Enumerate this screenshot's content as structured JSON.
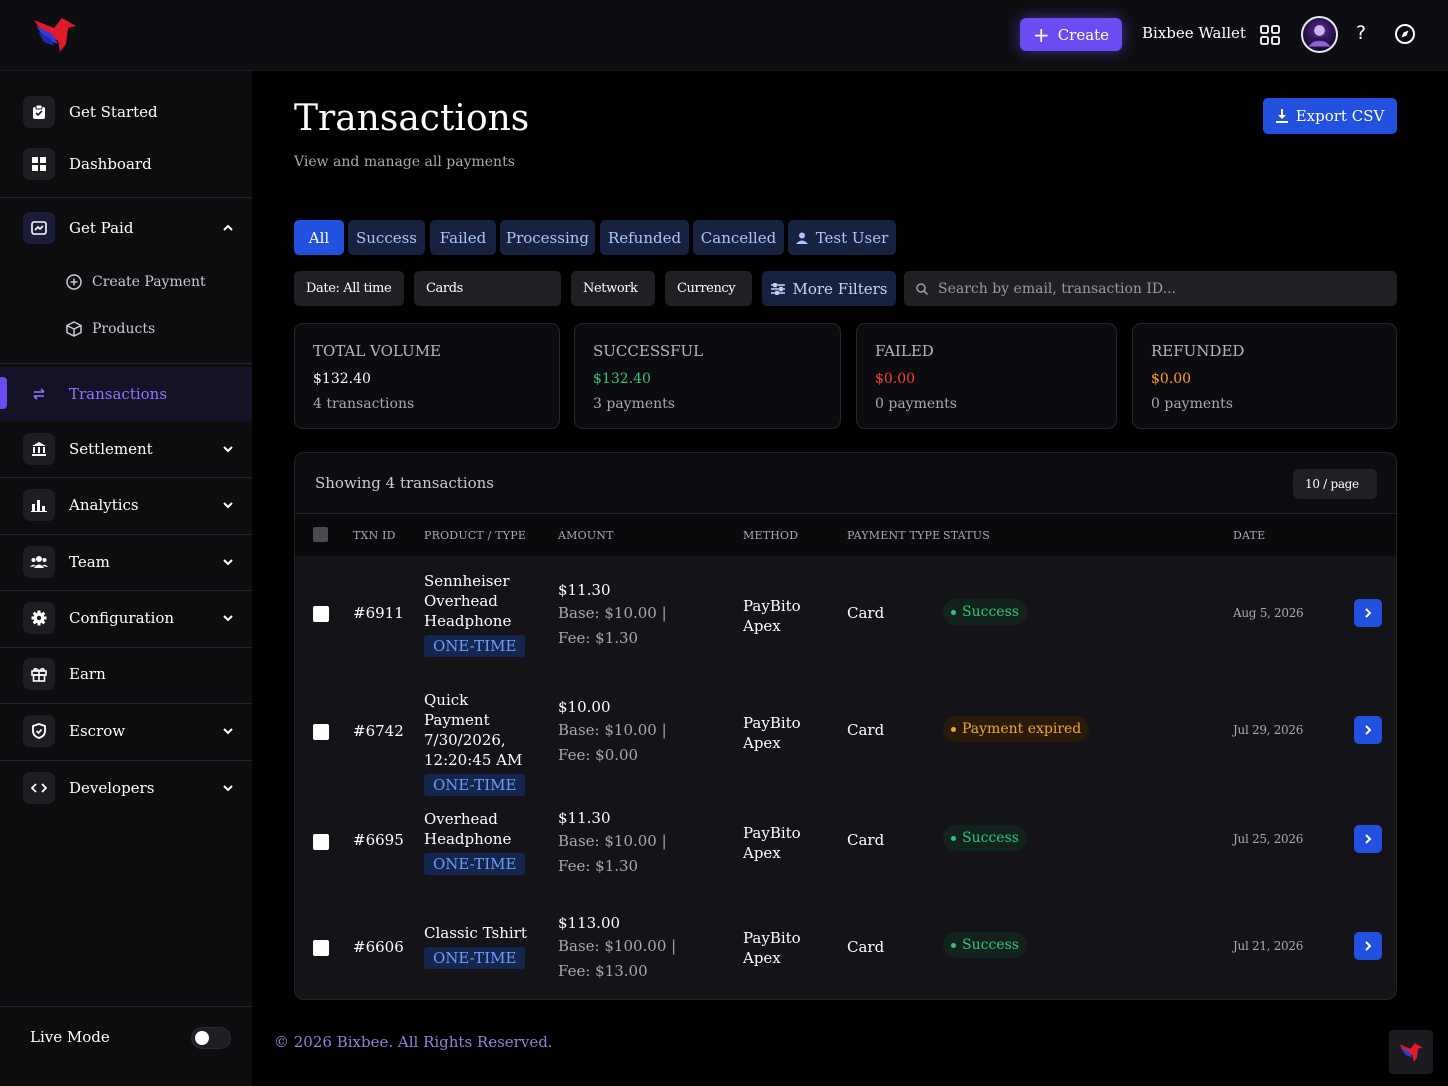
{
  "topbar": {
    "create_label": "Create",
    "wallet_label": "Bixbee Wallet",
    "help_label": "?"
  },
  "sidebar": {
    "items": [
      {
        "label": "Get Started",
        "icon": "clipboard-icon"
      },
      {
        "label": "Dashboard",
        "icon": "grid-icon"
      },
      {
        "label": "Get Paid",
        "icon": "payments-icon",
        "expanded": true
      },
      {
        "label": "Transactions",
        "icon": "transfer-icon",
        "active": true
      },
      {
        "label": "Settlement",
        "icon": "bank-icon"
      },
      {
        "label": "Analytics",
        "icon": "bar-chart-icon"
      },
      {
        "label": "Team",
        "icon": "team-icon"
      },
      {
        "label": "Configuration",
        "icon": "gear-icon"
      },
      {
        "label": "Earn",
        "icon": "gift-icon"
      },
      {
        "label": "Escrow",
        "icon": "shield-icon"
      },
      {
        "label": "Developers",
        "icon": "code-icon"
      }
    ],
    "sub_items": [
      {
        "label": "Create Payment",
        "icon": "plus-circle-icon"
      },
      {
        "label": "Products",
        "icon": "box-icon"
      }
    ],
    "live_mode_label": "Live Mode",
    "live_mode_on": false
  },
  "page": {
    "title": "Transactions",
    "subtitle": "View and manage all payments",
    "export_label": "Export CSV"
  },
  "tabs": [
    {
      "label": "All",
      "active": true
    },
    {
      "label": "Success"
    },
    {
      "label": "Failed"
    },
    {
      "label": "Processing"
    },
    {
      "label": "Refunded"
    },
    {
      "label": "Cancelled"
    },
    {
      "label": "Test User",
      "icon": "user-icon"
    }
  ],
  "filters": {
    "date": "Date: All time",
    "cards": "Cards",
    "network": "Network",
    "currency": "Currency",
    "more_filters": "More Filters",
    "search_placeholder": "Search by email, transaction ID..."
  },
  "stats": [
    {
      "label": "TOTAL VOLUME",
      "value": "$132.40",
      "sub": "4 transactions",
      "color": "#ffffff"
    },
    {
      "label": "SUCCESSFUL",
      "value": "$132.40",
      "sub": "3 payments",
      "color": "#33c47a"
    },
    {
      "label": "FAILED",
      "value": "$0.00",
      "sub": "0 payments",
      "color": "#ff3b3b"
    },
    {
      "label": "REFUNDED",
      "value": "$0.00",
      "sub": "0 payments",
      "color": "#ff9f1a"
    }
  ],
  "table": {
    "showing": "Showing 4 transactions",
    "per_page": "10 / page",
    "columns": [
      "TXN ID",
      "PRODUCT / TYPE",
      "AMOUNT",
      "METHOD",
      "PAYMENT TYPE",
      "STATUS",
      "DATE"
    ],
    "rows": [
      {
        "txn": "#6911",
        "product": "Sennheiser Overhead Headphone",
        "type": "ONE-TIME",
        "amount": "$11.30",
        "breakdown": "Base: $10.00 | Fee: $1.30",
        "method": "PayBito Apex",
        "payment_type": "Card",
        "status": "Success",
        "status_kind": "ok",
        "date": "Aug 5, 2026"
      },
      {
        "txn": "#6742",
        "product": "Quick Payment 7/30/2026, 12:20:45 AM",
        "type": "ONE-TIME",
        "amount": "$10.00",
        "breakdown": "Base: $10.00 | Fee: $0.00",
        "method": "PayBito Apex",
        "payment_type": "Card",
        "status": "Payment expired",
        "status_kind": "warn",
        "date": "Jul 29, 2026"
      },
      {
        "txn": "#6695",
        "product": "Overhead Headphone",
        "type": "ONE-TIME",
        "amount": "$11.30",
        "breakdown": "Base: $10.00 | Fee: $1.30",
        "method": "PayBito Apex",
        "payment_type": "Card",
        "status": "Success",
        "status_kind": "ok",
        "date": "Jul 25, 2026"
      },
      {
        "txn": "#6606",
        "product": "Classic Tshirt",
        "type": "ONE-TIME",
        "amount": "$113.00",
        "breakdown": "Base: $100.00 | Fee: $13.00",
        "method": "PayBito Apex",
        "payment_type": "Card",
        "status": "Success",
        "status_kind": "ok",
        "date": "Jul 21, 2026"
      }
    ]
  },
  "footer": "© 2026 Bixbee. All Rights Reserved.",
  "colors": {
    "accent": "#6c4cf2",
    "primary": "#2251e0",
    "success": "#33c47a",
    "danger": "#ff3b3b",
    "warning": "#ff9f1a"
  }
}
